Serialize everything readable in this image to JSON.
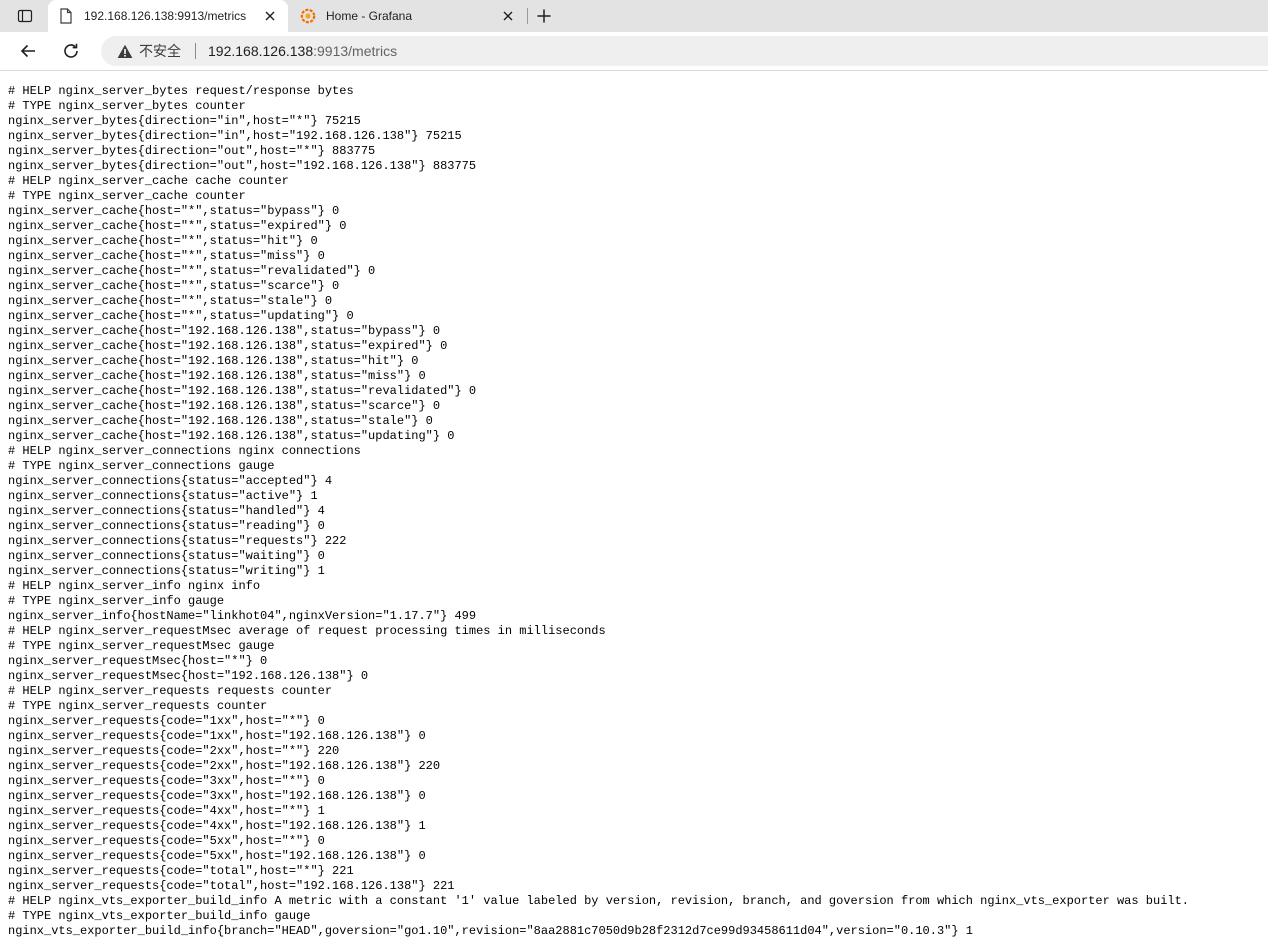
{
  "browser": {
    "tabs": [
      {
        "title": "192.168.126.138:9913/metrics",
        "active": true,
        "icon": "page-icon"
      },
      {
        "title": "Home - Grafana",
        "active": false,
        "icon": "grafana-icon"
      }
    ],
    "address_bar": {
      "security_label": "不安全",
      "host": "192.168.126.138",
      "path": ":9913/metrics"
    }
  },
  "colors": {
    "tabstrip": "#e3e3e3",
    "omnibox": "#efefef",
    "grafana_orange": "#f46800"
  },
  "page": {
    "lines": [
      "# HELP nginx_server_bytes request/response bytes",
      "# TYPE nginx_server_bytes counter",
      "nginx_server_bytes{direction=\"in\",host=\"*\"} 75215",
      "nginx_server_bytes{direction=\"in\",host=\"192.168.126.138\"} 75215",
      "nginx_server_bytes{direction=\"out\",host=\"*\"} 883775",
      "nginx_server_bytes{direction=\"out\",host=\"192.168.126.138\"} 883775",
      "# HELP nginx_server_cache cache counter",
      "# TYPE nginx_server_cache counter",
      "nginx_server_cache{host=\"*\",status=\"bypass\"} 0",
      "nginx_server_cache{host=\"*\",status=\"expired\"} 0",
      "nginx_server_cache{host=\"*\",status=\"hit\"} 0",
      "nginx_server_cache{host=\"*\",status=\"miss\"} 0",
      "nginx_server_cache{host=\"*\",status=\"revalidated\"} 0",
      "nginx_server_cache{host=\"*\",status=\"scarce\"} 0",
      "nginx_server_cache{host=\"*\",status=\"stale\"} 0",
      "nginx_server_cache{host=\"*\",status=\"updating\"} 0",
      "nginx_server_cache{host=\"192.168.126.138\",status=\"bypass\"} 0",
      "nginx_server_cache{host=\"192.168.126.138\",status=\"expired\"} 0",
      "nginx_server_cache{host=\"192.168.126.138\",status=\"hit\"} 0",
      "nginx_server_cache{host=\"192.168.126.138\",status=\"miss\"} 0",
      "nginx_server_cache{host=\"192.168.126.138\",status=\"revalidated\"} 0",
      "nginx_server_cache{host=\"192.168.126.138\",status=\"scarce\"} 0",
      "nginx_server_cache{host=\"192.168.126.138\",status=\"stale\"} 0",
      "nginx_server_cache{host=\"192.168.126.138\",status=\"updating\"} 0",
      "# HELP nginx_server_connections nginx connections",
      "# TYPE nginx_server_connections gauge",
      "nginx_server_connections{status=\"accepted\"} 4",
      "nginx_server_connections{status=\"active\"} 1",
      "nginx_server_connections{status=\"handled\"} 4",
      "nginx_server_connections{status=\"reading\"} 0",
      "nginx_server_connections{status=\"requests\"} 222",
      "nginx_server_connections{status=\"waiting\"} 0",
      "nginx_server_connections{status=\"writing\"} 1",
      "# HELP nginx_server_info nginx info",
      "# TYPE nginx_server_info gauge",
      "nginx_server_info{hostName=\"linkhot04\",nginxVersion=\"1.17.7\"} 499",
      "# HELP nginx_server_requestMsec average of request processing times in milliseconds",
      "# TYPE nginx_server_requestMsec gauge",
      "nginx_server_requestMsec{host=\"*\"} 0",
      "nginx_server_requestMsec{host=\"192.168.126.138\"} 0",
      "# HELP nginx_server_requests requests counter",
      "# TYPE nginx_server_requests counter",
      "nginx_server_requests{code=\"1xx\",host=\"*\"} 0",
      "nginx_server_requests{code=\"1xx\",host=\"192.168.126.138\"} 0",
      "nginx_server_requests{code=\"2xx\",host=\"*\"} 220",
      "nginx_server_requests{code=\"2xx\",host=\"192.168.126.138\"} 220",
      "nginx_server_requests{code=\"3xx\",host=\"*\"} 0",
      "nginx_server_requests{code=\"3xx\",host=\"192.168.126.138\"} 0",
      "nginx_server_requests{code=\"4xx\",host=\"*\"} 1",
      "nginx_server_requests{code=\"4xx\",host=\"192.168.126.138\"} 1",
      "nginx_server_requests{code=\"5xx\",host=\"*\"} 0",
      "nginx_server_requests{code=\"5xx\",host=\"192.168.126.138\"} 0",
      "nginx_server_requests{code=\"total\",host=\"*\"} 221",
      "nginx_server_requests{code=\"total\",host=\"192.168.126.138\"} 221",
      "# HELP nginx_vts_exporter_build_info A metric with a constant '1' value labeled by version, revision, branch, and goversion from which nginx_vts_exporter was built.",
      "# TYPE nginx_vts_exporter_build_info gauge",
      "nginx_vts_exporter_build_info{branch=\"HEAD\",goversion=\"go1.10\",revision=\"8aa2881c7050d9b28f2312d7ce99d93458611d04\",version=\"0.10.3\"} 1"
    ]
  }
}
